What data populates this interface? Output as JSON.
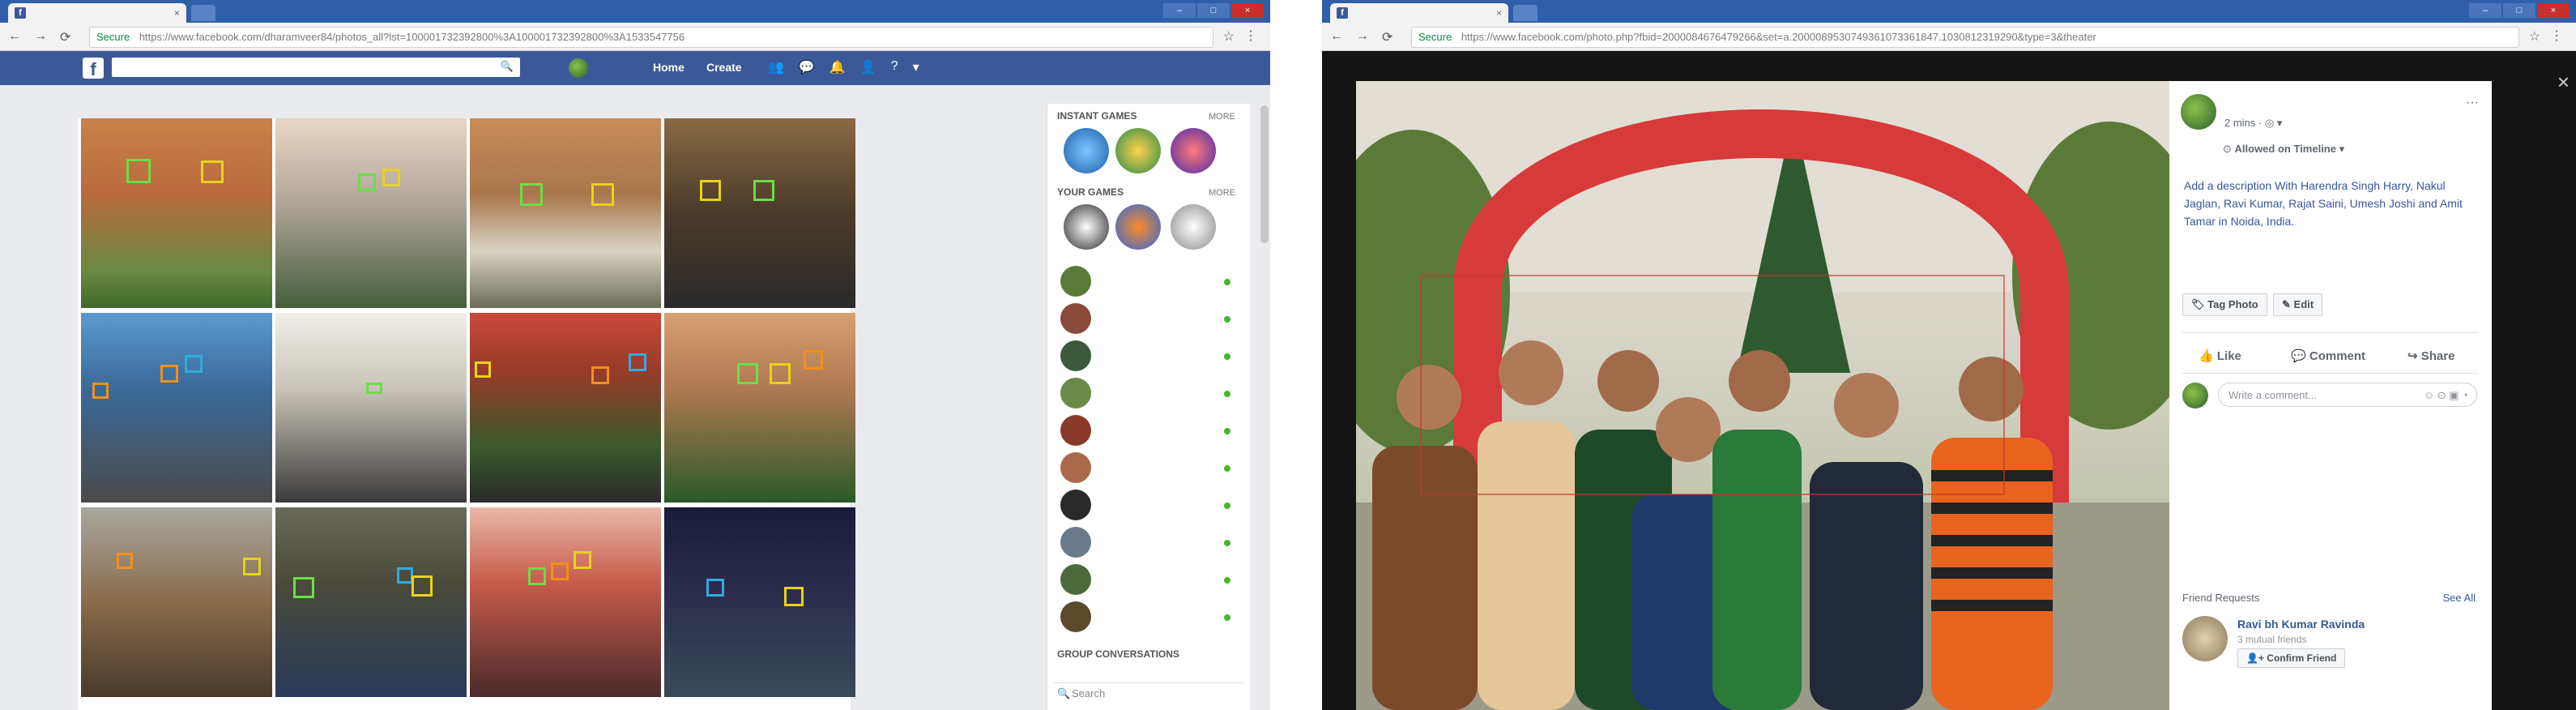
{
  "left_window": {
    "tab_title": "",
    "url_secure_label": "Secure",
    "url": "https://www.facebook.com/dharamveer84/photos_all?lst=100001732392800%3A100001732392800%3A1533547756",
    "nav": {
      "home": "Home",
      "create": "Create"
    },
    "rail": {
      "instant_games_label": "INSTANT GAMES",
      "instant_games_more": "MORE",
      "your_games_label": "YOUR GAMES",
      "your_games_more": "MORE",
      "group_conversations_label": "GROUP CONVERSATIONS",
      "search_placeholder": "Search"
    }
  },
  "right_window": {
    "url_secure_label": "Secure",
    "url": "https://www.facebook.com/photo.php?fbid=2000084676479266&set=a.2000089530749361073361847.1030812319290&type=3&theater",
    "post_time": "2 mins",
    "audience": "Allowed on Timeline",
    "description": "Add a description With Harendra Singh Harry, Nakul Jaglan, Ravi Kumar, Rajat Saini, Umesh Joshi and Amit Tamar in Noida, India.",
    "tag_photo": "Tag Photo",
    "edit": "Edit",
    "like": "Like",
    "comment": "Comment",
    "share": "Share",
    "comment_placeholder": "Write a comment...",
    "friend_requests_label": "Friend Requests",
    "see_all": "See All",
    "friend_name": "Ravi bh Kumar Ravinda",
    "mutual": "3 mutual friends",
    "confirm_friend": "Confirm Friend"
  }
}
